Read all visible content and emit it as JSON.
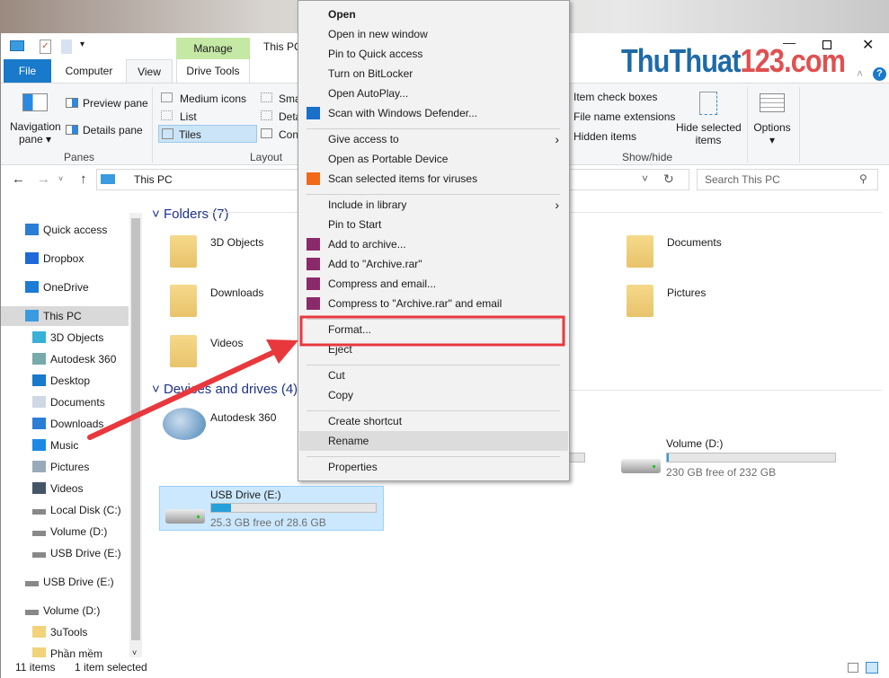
{
  "window": {
    "title": "This PC",
    "contextual_tab": "Manage",
    "contextual_group": "Drive Tools"
  },
  "watermark": "ThuThuat123.com",
  "tabs": [
    {
      "label": "File"
    },
    {
      "label": "Computer"
    },
    {
      "label": "View",
      "selected": true
    },
    {
      "label": "Drive Tools"
    }
  ],
  "ribbon": {
    "panes": {
      "navigation_pane": "Navigation",
      "navigation_pane2": "pane",
      "preview_pane": "Preview pane",
      "details_pane": "Details pane",
      "group": "Panes"
    },
    "layout": {
      "medium_icons": "Medium icons",
      "list": "List",
      "tiles": "Tiles",
      "small": "Sma",
      "details": "Deta",
      "content": "Con",
      "group": "Layout"
    },
    "showhide": {
      "item_check_boxes": "Item check boxes",
      "file_name_extensions": "File name extensions",
      "hidden_items": "Hidden items",
      "hide_selected": "Hide selected",
      "hide_selected2": "items",
      "group": "Show/hide"
    },
    "options": "Options"
  },
  "address": {
    "path": "This PC",
    "search_placeholder": "Search This PC"
  },
  "nav": [
    {
      "label": "Quick access",
      "icon": "star-icon",
      "indent": 0
    },
    {
      "label": "Dropbox",
      "icon": "dropbox-icon",
      "indent": 0
    },
    {
      "label": "OneDrive",
      "icon": "cloud-icon",
      "indent": 0
    },
    {
      "label": "This PC",
      "icon": "computer-icon",
      "indent": 0,
      "selected": true
    },
    {
      "label": "3D Objects",
      "icon": "cube-icon",
      "indent": 1
    },
    {
      "label": "Autodesk 360",
      "icon": "autodesk-icon",
      "indent": 1
    },
    {
      "label": "Desktop",
      "icon": "desktop-icon",
      "indent": 1
    },
    {
      "label": "Documents",
      "icon": "document-icon",
      "indent": 1
    },
    {
      "label": "Downloads",
      "icon": "download-icon",
      "indent": 1
    },
    {
      "label": "Music",
      "icon": "music-icon",
      "indent": 1
    },
    {
      "label": "Pictures",
      "icon": "pictures-icon",
      "indent": 1
    },
    {
      "label": "Videos",
      "icon": "videos-icon",
      "indent": 1
    },
    {
      "label": "Local Disk (C:)",
      "icon": "drive-icon",
      "indent": 1
    },
    {
      "label": "Volume (D:)",
      "icon": "drive-icon",
      "indent": 1
    },
    {
      "label": "USB Drive (E:)",
      "icon": "drive-icon",
      "indent": 1
    },
    {
      "label": "USB Drive (E:)",
      "icon": "drive-icon",
      "indent": 0
    },
    {
      "label": "Volume (D:)",
      "icon": "drive-icon",
      "indent": 0
    },
    {
      "label": "3uTools",
      "icon": "folder-icon",
      "indent": 1
    },
    {
      "label": "Phần mềm",
      "icon": "folder-icon",
      "indent": 1
    }
  ],
  "folders": {
    "header": "Folders (7)",
    "items": [
      "3D Objects",
      "Downloads",
      "Videos",
      "Documents",
      "Pictures"
    ]
  },
  "drives": {
    "header": "Devices and drives (4)",
    "autodesk": "Autodesk 360",
    "usb": {
      "name": "USB Drive (E:)",
      "free": "25.3 GB free of 28.6 GB",
      "used_pct": 12
    },
    "volume": {
      "name": "Volume (D:)",
      "free": "230 GB free of 232 GB",
      "used_pct": 1
    }
  },
  "context_menu": [
    {
      "label": "Open",
      "bold": true
    },
    {
      "label": "Open in new window"
    },
    {
      "label": "Pin to Quick access"
    },
    {
      "label": "Turn on BitLocker"
    },
    {
      "label": "Open AutoPlay..."
    },
    {
      "label": "Scan with Windows Defender...",
      "icon": "defender-icon"
    },
    {
      "label": "Give access to",
      "submenu": true
    },
    {
      "label": "Open as Portable Device"
    },
    {
      "label": "Scan selected items for viruses",
      "icon": "avast-icon"
    },
    {
      "label": "Include in library",
      "submenu": true
    },
    {
      "label": "Pin to Start"
    },
    {
      "label": "Add to archive...",
      "icon": "winrar-icon"
    },
    {
      "label": "Add to \"Archive.rar\"",
      "icon": "winrar-icon"
    },
    {
      "label": "Compress and email...",
      "icon": "winrar-icon"
    },
    {
      "label": "Compress to \"Archive.rar\" and email",
      "icon": "winrar-icon"
    },
    {
      "label": "Format...",
      "annotated": true
    },
    {
      "label": "Eject"
    },
    {
      "label": "Cut"
    },
    {
      "label": "Copy"
    },
    {
      "label": "Create shortcut"
    },
    {
      "label": "Rename",
      "highlighted": true
    },
    {
      "label": "Properties"
    }
  ],
  "status": {
    "count": "11 items",
    "selected": "1 item selected"
  },
  "colors": {
    "accent": "#1979ca",
    "annotation": "#e8383d",
    "manage_tab": "#c5e8a5"
  }
}
